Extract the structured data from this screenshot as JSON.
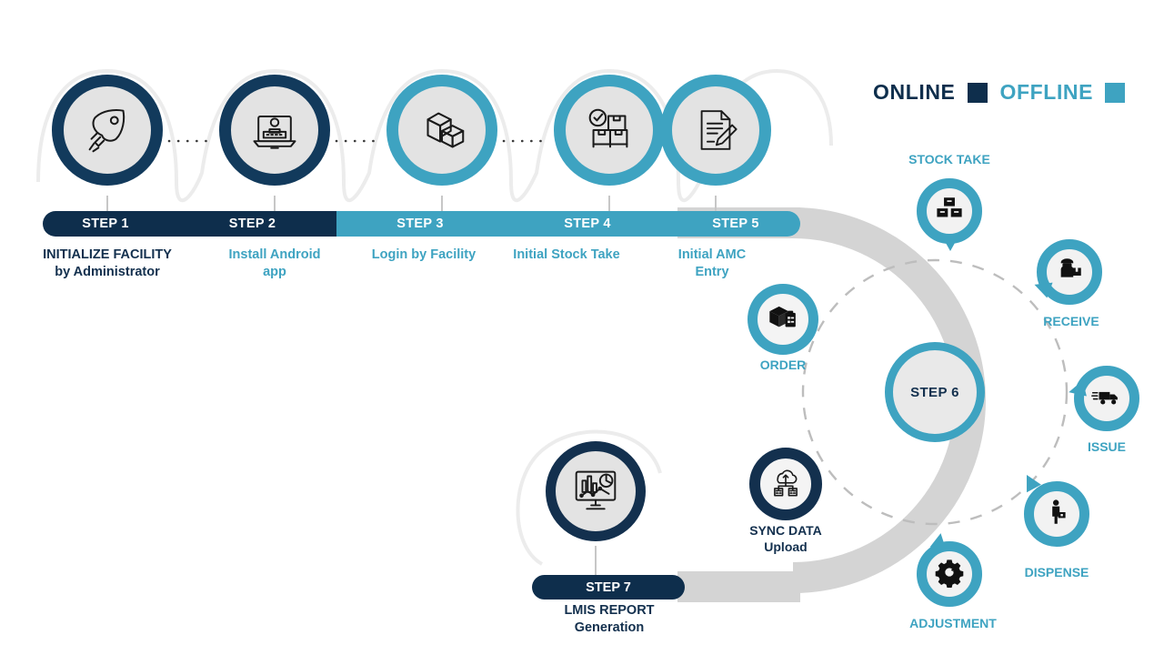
{
  "legend": {
    "online": {
      "label": "ONLINE",
      "color": "#0e2e4c"
    },
    "offline": {
      "label": "OFFLINE",
      "color": "#3ea3c1"
    }
  },
  "timeline": {
    "steps": [
      {
        "pill": "STEP 1",
        "caption_line1": "INITIALIZE FACILITY",
        "caption_line2": "by Administrator",
        "mode": "online",
        "icon": "rocket-icon"
      },
      {
        "pill": "STEP 2",
        "caption_line1": "Install Android",
        "caption_line2": "app",
        "mode": "online",
        "icon": "laptop-user-icon"
      },
      {
        "pill": "STEP 3",
        "caption_line1": "Login by Facility",
        "caption_line2": "",
        "mode": "offline",
        "icon": "boxes-3d-icon"
      },
      {
        "pill": "STEP 4",
        "caption_line1": "Initial Stock Take",
        "caption_line2": "",
        "mode": "offline",
        "icon": "checked-cartons-icon"
      },
      {
        "pill": "STEP 5",
        "caption_line1": "Initial AMC",
        "caption_line2": "Entry",
        "mode": "offline",
        "icon": "document-pen-icon"
      }
    ]
  },
  "hub": {
    "label": "STEP 6",
    "mode": "offline"
  },
  "operations": [
    {
      "label": "STOCK TAKE",
      "mode": "offline",
      "icon": "stacked-boxes-icon"
    },
    {
      "label": "RECEIVE",
      "mode": "offline",
      "icon": "worker-package-icon"
    },
    {
      "label": "ISSUE",
      "mode": "offline",
      "icon": "delivery-truck-icon"
    },
    {
      "label": "DISPENSE",
      "mode": "offline",
      "icon": "person-bag-icon"
    },
    {
      "label": "ADJUSTMENT",
      "mode": "offline",
      "icon": "gear-refresh-icon"
    },
    {
      "label": "ORDER",
      "mode": "offline",
      "icon": "box-clipboard-icon"
    }
  ],
  "sync": {
    "label_line1": "SYNC DATA",
    "label_line2": "Upload",
    "mode": "online",
    "icon": "cloud-upload-server-icon"
  },
  "report": {
    "pill": "STEP 7",
    "caption_line1": "LMIS REPORT",
    "caption_line2": "Generation",
    "mode": "online",
    "icon": "dashboard-chart-icon"
  },
  "palette": {
    "navy": "#0e2e4c",
    "navy_ring": "#13304e",
    "teal": "#3ea3c1",
    "circle_fill": "#e3e3e3",
    "arc_gray": "#d4d4d4",
    "dash_gray": "#bdbdbd",
    "background": "#ffffff"
  }
}
